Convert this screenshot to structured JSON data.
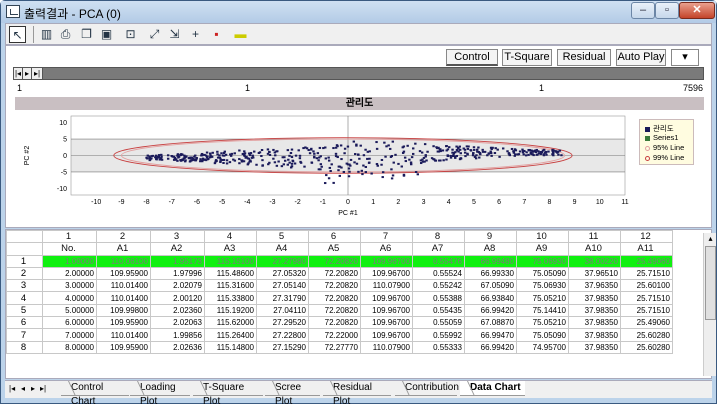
{
  "window": {
    "title": "출력결과 - PCA (0)"
  },
  "toolbar": {
    "items": [
      "pointer-icon",
      "columns-icon",
      "print-icon",
      "copy-icon",
      "save-icon",
      "zoom-icon",
      "fit-icon",
      "scale-icon",
      "crosshair-icon",
      "export-icon",
      "tag-icon"
    ]
  },
  "top_tabs": {
    "control": "Control",
    "tsquare": "T-Square",
    "residual": "Residual",
    "autoplay": "Auto Play"
  },
  "range": {
    "min": "1",
    "pos1": "1",
    "pos2": "1",
    "max": "7596"
  },
  "chart_data": {
    "type": "scatter",
    "title": "관리도",
    "xlabel": "PC #1",
    "ylabel": "PC #2",
    "xlim": [
      -11,
      11
    ],
    "ylim": [
      -12,
      12
    ],
    "xticks": [
      -10,
      -9,
      -8,
      -7,
      -6,
      -5,
      -4,
      -3,
      -2,
      -1,
      0,
      1,
      2,
      3,
      4,
      5,
      6,
      7,
      8,
      9,
      10,
      11
    ],
    "yticks": [
      10,
      5,
      0,
      -5,
      -10
    ],
    "ellipses": [
      {
        "name": "95% Line",
        "cx": -0.2,
        "cy": 0,
        "rx": 8.8,
        "ry": 5.0,
        "color": "#e2a0a0"
      },
      {
        "name": "99% Line",
        "cx": -0.2,
        "cy": 0,
        "rx": 9.1,
        "ry": 5.4,
        "color": "#c84040"
      }
    ],
    "legend": [
      "관리도",
      "Series1",
      "95% Line",
      "99% Line"
    ],
    "legend_placement": "right",
    "point_color": "#1a1a5a"
  },
  "grid": {
    "col_numbers": [
      "1",
      "2",
      "3",
      "4",
      "5",
      "6",
      "7",
      "8",
      "9",
      "10",
      "11",
      "12"
    ],
    "col_names": [
      "No.",
      "A1",
      "A2",
      "A3",
      "A4",
      "A5",
      "A6",
      "A7",
      "A8",
      "A9",
      "A10",
      "A11"
    ],
    "rows": [
      [
        "1",
        "1.00000",
        "110.06100",
        "1.95173",
        "115.15100",
        "27.27980",
        "72.20820",
        "109.96700",
        "0.55476",
        "66.99480",
        "75.06930",
        "38.00220",
        "25.49060"
      ],
      [
        "2",
        "2.00000",
        "109.95900",
        "1.97996",
        "115.48600",
        "27.05320",
        "72.20820",
        "109.96700",
        "0.55524",
        "66.99330",
        "75.05090",
        "37.96510",
        "25.71510"
      ],
      [
        "3",
        "3.00000",
        "110.01400",
        "2.02079",
        "115.31600",
        "27.05140",
        "72.20820",
        "110.07900",
        "0.55242",
        "67.05090",
        "75.06930",
        "37.96350",
        "25.60100"
      ],
      [
        "4",
        "4.00000",
        "110.01400",
        "2.00120",
        "115.33800",
        "27.31790",
        "72.20820",
        "109.96700",
        "0.55388",
        "66.93840",
        "75.05210",
        "37.98350",
        "25.71510"
      ],
      [
        "5",
        "5.00000",
        "109.99800",
        "2.02360",
        "115.19200",
        "27.04110",
        "72.20820",
        "109.96700",
        "0.55435",
        "66.99420",
        "75.14410",
        "37.98350",
        "25.71510"
      ],
      [
        "6",
        "6.00000",
        "109.95900",
        "2.02063",
        "115.62000",
        "27.29520",
        "72.20820",
        "109.96700",
        "0.55059",
        "67.08870",
        "75.05210",
        "37.98350",
        "25.49060"
      ],
      [
        "7",
        "7.00000",
        "110.01400",
        "1.99856",
        "115.26400",
        "27.22800",
        "72.22000",
        "109.96700",
        "0.55992",
        "66.99470",
        "75.05090",
        "37.98350",
        "25.60280"
      ],
      [
        "8",
        "8.00000",
        "109.95900",
        "2.02636",
        "115.14800",
        "27.15290",
        "72.27770",
        "110.07900",
        "0.55333",
        "66.99420",
        "74.95700",
        "37.98350",
        "25.60280"
      ]
    ]
  },
  "bottom_tabs": [
    "Control Chart",
    "Loading Plot",
    "T-Square Plot",
    "Scree Plot",
    "Residual Plot",
    "Contribution",
    "Data Chart"
  ],
  "active_bottom_tab": "Data Chart"
}
